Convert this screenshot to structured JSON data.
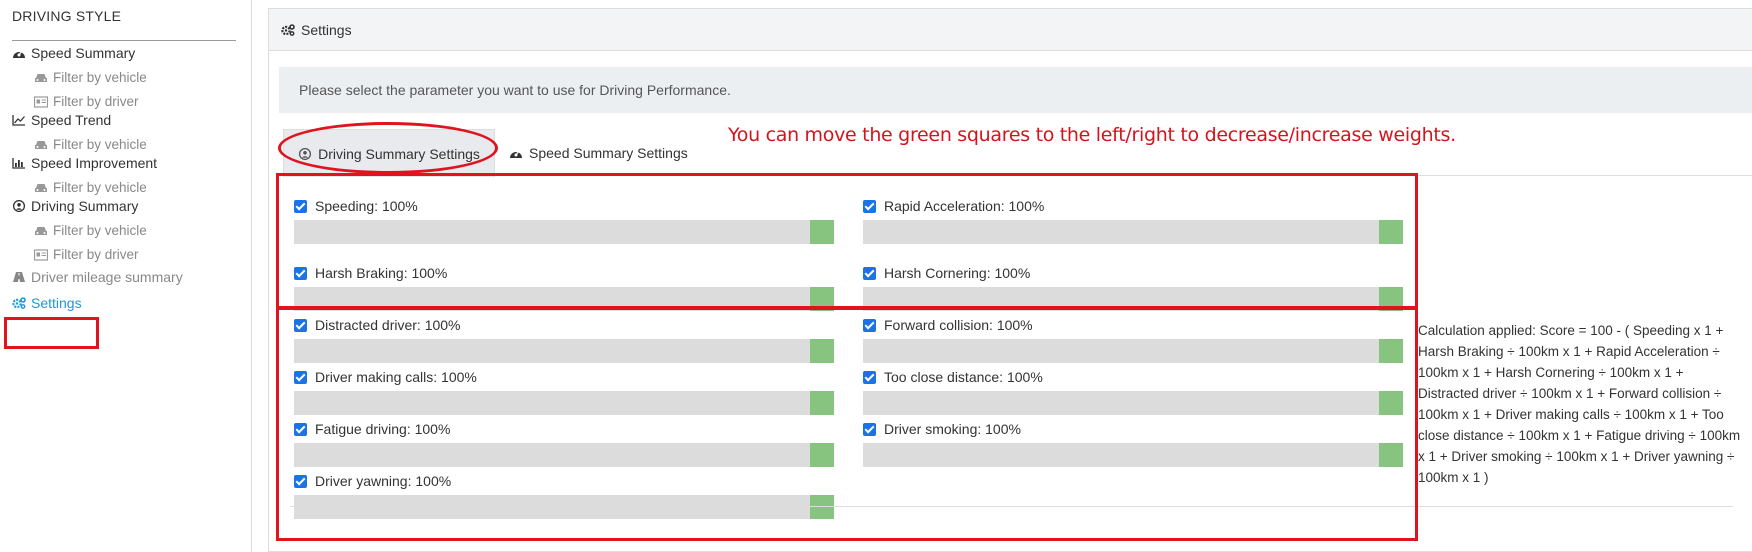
{
  "sidebar": {
    "heading": "DRIVING STYLE",
    "items": [
      {
        "label": "Speed Summary",
        "icon": "speedometer-icon"
      },
      {
        "label": "Filter by vehicle",
        "icon": "car-icon"
      },
      {
        "label": "Filter by driver",
        "icon": "id-card-icon"
      },
      {
        "label": "Speed Trend",
        "icon": "line-chart-icon"
      },
      {
        "label": "Filter by vehicle",
        "icon": "car-icon"
      },
      {
        "label": "Speed Improvement",
        "icon": "bar-chart-icon"
      },
      {
        "label": "Filter by vehicle",
        "icon": "car-icon"
      },
      {
        "label": "Driving Summary",
        "icon": "user-circle-icon"
      },
      {
        "label": "Filter by vehicle",
        "icon": "car-icon"
      },
      {
        "label": "Filter by driver",
        "icon": "id-card-icon"
      },
      {
        "label": "Driver mileage summary",
        "icon": "road-icon"
      },
      {
        "label": "Settings",
        "icon": "cogs-icon"
      }
    ]
  },
  "panel": {
    "title": "Settings",
    "info": "Please select the parameter you want to use for Driving Performance.",
    "tabs": [
      "Driving Summary Settings",
      "Speed Summary Settings"
    ],
    "hint": "You can move the green squares to the left/right to decrease/increase weights."
  },
  "params": [
    {
      "label": "Speeding: 100%",
      "weight": 1.0
    },
    {
      "label": "Rapid Acceleration: 100%",
      "weight": 1.0
    },
    {
      "label": "Harsh Braking: 100%",
      "weight": 1.0
    },
    {
      "label": "Harsh Cornering: 100%",
      "weight": 1.0
    },
    {
      "label": "Distracted driver: 100%",
      "weight": 1.0
    },
    {
      "label": "Forward collision: 100%",
      "weight": 1.0
    },
    {
      "label": "Driver making calls: 100%",
      "weight": 1.0
    },
    {
      "label": "Too close distance: 100%",
      "weight": 1.0
    },
    {
      "label": "Fatigue driving: 100%",
      "weight": 1.0
    },
    {
      "label": "Driver smoking: 100%",
      "weight": 1.0
    },
    {
      "label": "Driver yawning: 100%",
      "weight": 1.0
    }
  ],
  "calculation": "Calculation applied: Score = 100 - ( Speeding x 1 + Harsh Braking ÷ 100km x 1 + Rapid Acceleration ÷ 100km x 1 + Harsh Cornering ÷ 100km x 1 + Distracted driver ÷ 100km x 1 + Forward collision ÷ 100km x 1 + Driver making calls ÷ 100km x 1 + Too close distance ÷ 100km x 1 + Fatigue driving ÷ 100km x 1 + Driver smoking ÷ 100km x 1 + Driver yawning ÷ 100km x 1 )",
  "colors": {
    "accent": "#1a9bd7",
    "highlight": "#e0141e",
    "handle": "#86c47f",
    "checkbox": "#1a73e8"
  }
}
